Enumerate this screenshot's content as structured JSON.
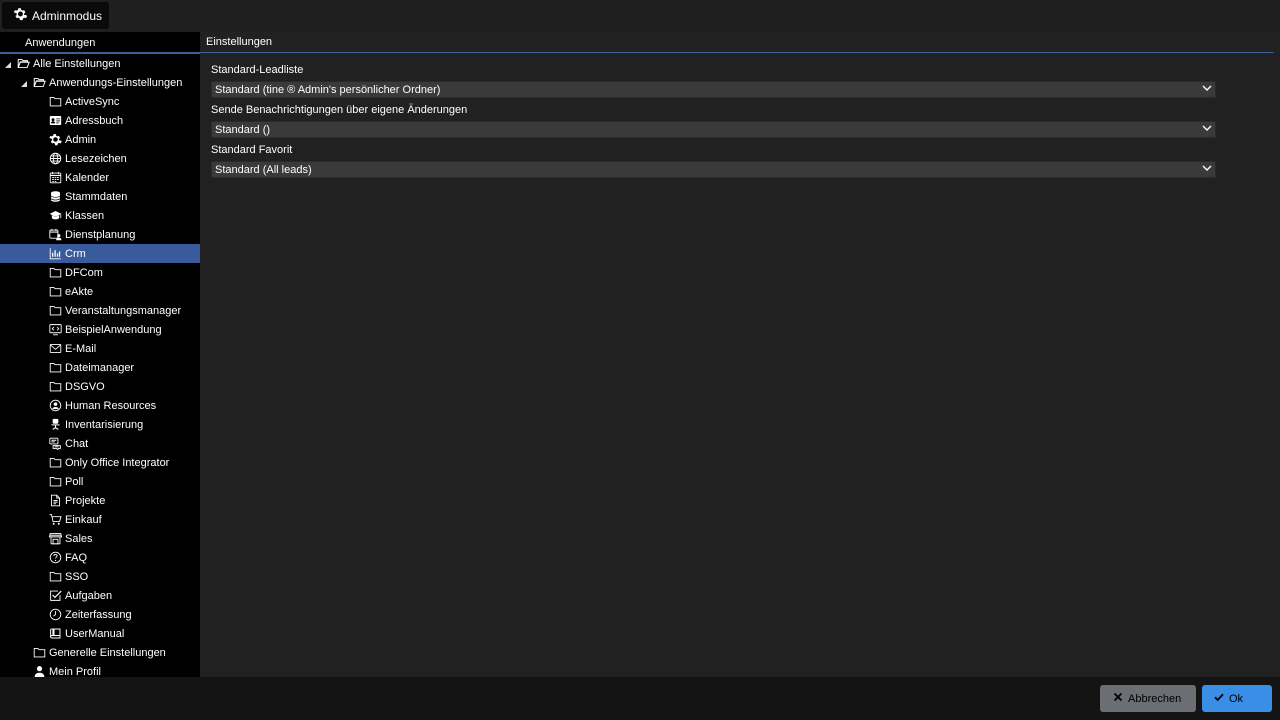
{
  "topbar": {
    "admin_label": "Adminmodus"
  },
  "left": {
    "header": "Anwendungen",
    "root": {
      "label": "Alle Einstellungen",
      "icon": "folder-open-icon"
    },
    "app_settings": {
      "label": "Anwendungs-Einstellungen",
      "icon": "folder-open-icon"
    },
    "apps": [
      {
        "label": "ActiveSync",
        "icon": "folder-icon"
      },
      {
        "label": "Adressbuch",
        "icon": "address-card-icon"
      },
      {
        "label": "Admin",
        "icon": "gear-icon"
      },
      {
        "label": "Lesezeichen",
        "icon": "globe-icon"
      },
      {
        "label": "Kalender",
        "icon": "calendar-icon"
      },
      {
        "label": "Stammdaten",
        "icon": "database-icon"
      },
      {
        "label": "Klassen",
        "icon": "graduation-cap-icon"
      },
      {
        "label": "Dienstplanung",
        "icon": "calendar-user-icon"
      },
      {
        "label": "Crm",
        "icon": "bar-chart-icon"
      },
      {
        "label": "DFCom",
        "icon": "folder-icon"
      },
      {
        "label": "eAkte",
        "icon": "folder-icon"
      },
      {
        "label": "Veranstaltungsmanager",
        "icon": "folder-icon"
      },
      {
        "label": "BeispielAnwendung",
        "icon": "code-window-icon"
      },
      {
        "label": "E-Mail",
        "icon": "envelope-icon"
      },
      {
        "label": "Dateimanager",
        "icon": "folder-icon"
      },
      {
        "label": "DSGVO",
        "icon": "folder-icon"
      },
      {
        "label": "Human Resources",
        "icon": "user-circle-icon"
      },
      {
        "label": "Inventarisierung",
        "icon": "chair-icon"
      },
      {
        "label": "Chat",
        "icon": "chat-icon"
      },
      {
        "label": "Only Office Integrator",
        "icon": "folder-icon"
      },
      {
        "label": "Poll",
        "icon": "folder-icon"
      },
      {
        "label": "Projekte",
        "icon": "document-icon"
      },
      {
        "label": "Einkauf",
        "icon": "cart-icon"
      },
      {
        "label": "Sales",
        "icon": "store-icon"
      },
      {
        "label": "FAQ",
        "icon": "question-circle-icon"
      },
      {
        "label": "SSO",
        "icon": "folder-icon"
      },
      {
        "label": "Aufgaben",
        "icon": "checkbox-icon"
      },
      {
        "label": "Zeiterfassung",
        "icon": "clock-icon"
      },
      {
        "label": "UserManual",
        "icon": "book-icon"
      }
    ],
    "selected_app": "Crm",
    "general": {
      "label": "Generelle Einstellungen",
      "icon": "folder-icon"
    },
    "profile": {
      "label": "Mein Profil",
      "icon": "user-icon"
    }
  },
  "right": {
    "header": "Einstellungen",
    "fields": [
      {
        "label": "Standard-Leadliste",
        "value": "Standard (tine ® Admin's persönlicher Ordner)"
      },
      {
        "label": "Sende Benachrichtigungen über eigene Änderungen",
        "value": "Standard ()"
      },
      {
        "label": "Standard Favorit",
        "value": "Standard (All leads)"
      }
    ]
  },
  "bottom": {
    "cancel_label": "Abbrechen",
    "ok_label": "Ok"
  },
  "colors": {
    "selected": "#3a5b9b",
    "accent_line": "#3b5f99",
    "ok_button": "#3a8ee6",
    "cancel_button": "#6b6e73"
  }
}
